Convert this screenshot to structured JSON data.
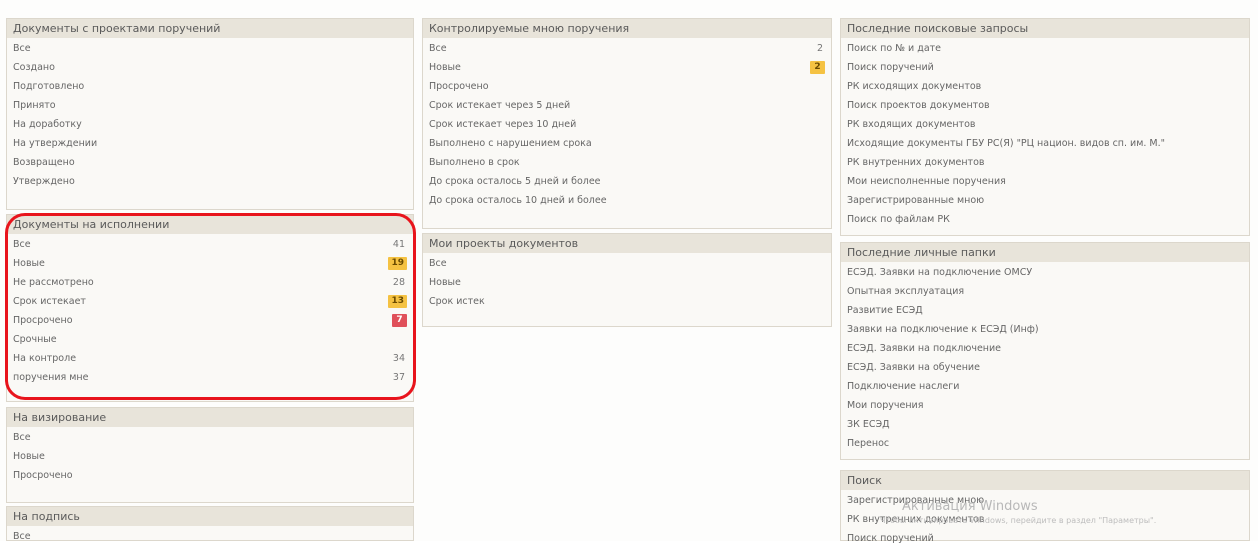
{
  "col1": {
    "projects": {
      "title": "Документы с проектами поручений",
      "items": [
        {
          "label": "Все"
        },
        {
          "label": "Создано"
        },
        {
          "label": "Подготовлено"
        },
        {
          "label": "Принято"
        },
        {
          "label": "На доработку"
        },
        {
          "label": "На утверждении"
        },
        {
          "label": "Возвращено"
        },
        {
          "label": "Утверждено"
        }
      ]
    },
    "execution": {
      "title": "Документы на исполнении",
      "items": [
        {
          "label": "Все",
          "count": "41"
        },
        {
          "label": "Новые",
          "badge": "19"
        },
        {
          "label": "Не рассмотрено",
          "count": "28"
        },
        {
          "label": "Срок истекает",
          "badge": "13"
        },
        {
          "label": "Просрочено",
          "badge_red": "7"
        },
        {
          "label": "Срочные"
        },
        {
          "label": "На контроле",
          "count": "34"
        },
        {
          "label": "поручения мне",
          "count": "37"
        }
      ]
    },
    "visa": {
      "title": "На визирование",
      "items": [
        {
          "label": "Все"
        },
        {
          "label": "Новые"
        },
        {
          "label": "Просрочено"
        }
      ]
    },
    "sign": {
      "title": "На подпись",
      "items": [
        {
          "label": "Все"
        }
      ]
    }
  },
  "col2": {
    "controlled": {
      "title": "Контролируемые мною поручения",
      "items": [
        {
          "label": "Все",
          "count": "2"
        },
        {
          "label": "Новые",
          "badge": "2"
        },
        {
          "label": "Просрочено"
        },
        {
          "label": "Срок истекает через 5 дней"
        },
        {
          "label": "Срок истекает через 10 дней"
        },
        {
          "label": "Выполнено с нарушением срока"
        },
        {
          "label": "Выполнено в срок"
        },
        {
          "label": "До срока осталось 5 дней и более"
        },
        {
          "label": "До срока осталось 10 дней и более"
        }
      ]
    },
    "myprojects": {
      "title": "Мои проекты документов",
      "items": [
        {
          "label": "Все"
        },
        {
          "label": "Новые"
        },
        {
          "label": "Срок истек"
        }
      ]
    }
  },
  "col3": {
    "recent_searches": {
      "title": "Последние поисковые запросы",
      "items": [
        {
          "label": "Поиск по № и дате"
        },
        {
          "label": "Поиск поручений"
        },
        {
          "label": "РК исходящих документов"
        },
        {
          "label": "Поиск проектов документов"
        },
        {
          "label": "РК входящих документов"
        },
        {
          "label": "Исходящие документы ГБУ РС(Я) \"РЦ национ. видов сп. им. М.\""
        },
        {
          "label": "РК внутренних документов"
        },
        {
          "label": "Мои неисполненные поручения"
        },
        {
          "label": "Зарегистрированные мною"
        },
        {
          "label": "Поиск по файлам РК"
        }
      ]
    },
    "personal_folders": {
      "title": "Последние личные папки",
      "items": [
        {
          "label": "ЕСЭД. Заявки на подключение ОМСУ"
        },
        {
          "label": "Опытная эксплуатация"
        },
        {
          "label": "Развитие ЕСЭД"
        },
        {
          "label": "Заявки на подключение к ЕСЭД (Инф)"
        },
        {
          "label": "ЕСЭД. Заявки на подключение"
        },
        {
          "label": "ЕСЭД. Заявки на обучение"
        },
        {
          "label": "Подключение наслеги"
        },
        {
          "label": "Мои поручения"
        },
        {
          "label": "ЗК ЕСЭД"
        },
        {
          "label": "Перенос"
        }
      ]
    },
    "search": {
      "title": "Поиск",
      "items": [
        {
          "label": "Зарегистрированные мною"
        },
        {
          "label": "РК внутренних документов"
        },
        {
          "label": "Поиск поручений"
        }
      ]
    }
  },
  "watermark": {
    "title": "Активация Windows",
    "subtitle": "Чтобы активировать Windows, перейдите в раздел \"Параметры\"."
  }
}
